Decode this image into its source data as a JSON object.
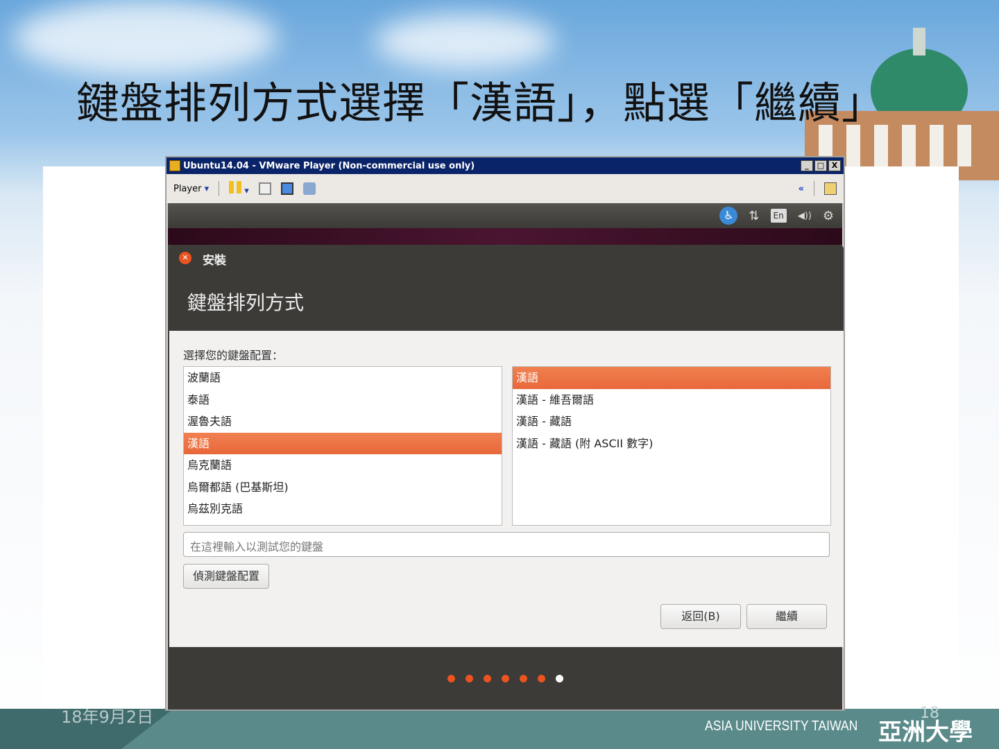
{
  "slide": {
    "title": "鍵盤排列方式選擇「漢語」，點選「繼續」",
    "date": "18年9月2日",
    "page_number": "18",
    "university_en": "ASIA UNIVERSITY TAIWAN",
    "university_zh": "亞洲大學"
  },
  "window": {
    "title": "Ubuntu14.04 - VMware Player (Non-commercial use only)",
    "min": "_",
    "max": "□",
    "close": "X"
  },
  "toolbar": {
    "player_label": "Player",
    "collapse": "«"
  },
  "topbar": {
    "lang": "En",
    "network": "⇅",
    "volume": "◀))",
    "settings": "⚙",
    "a11y": "♿"
  },
  "dialog": {
    "app": "安裝",
    "heading": "鍵盤排列方式",
    "prompt": "選擇您的鍵盤配置：",
    "layouts": [
      "波蘭語",
      "泰語",
      "渥魯夫語",
      "漢語",
      "烏克蘭語",
      "烏爾都語 (巴基斯坦)",
      "烏茲別克語"
    ],
    "selected_layout": 3,
    "variants": [
      "漢語",
      "漢語 - 維吾爾語",
      "漢語 - 藏語",
      "漢語 - 藏語 (附 ASCII 數字)"
    ],
    "selected_variant": 0,
    "test_placeholder": "在這裡輸入以測試您的鍵盤",
    "detect_button": "偵測鍵盤配置",
    "back_button": "返回(B)",
    "continue_button": "繼續"
  },
  "progress": {
    "steps": 7,
    "current": 7
  },
  "colors": {
    "accent": "#e95420",
    "titlebar": "#0a246a"
  }
}
